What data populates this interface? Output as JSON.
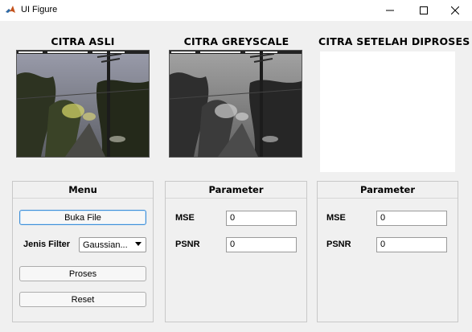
{
  "window": {
    "title": "UI Figure",
    "app_icon": "matlab-icon",
    "controls": [
      "minimize-icon",
      "maximize-icon",
      "close-icon"
    ]
  },
  "images": {
    "original_title": "CITRA ASLI",
    "greyscale_title": "CITRA GREYSCALE",
    "processed_title": "CITRA SETELAH DIPROSES"
  },
  "menu_panel": {
    "title": "Menu",
    "open_file_label": "Buka File",
    "filter_label": "Jenis Filter",
    "filter_selected": "Gaussian...",
    "process_label": "Proses",
    "reset_label": "Reset"
  },
  "param_panel_1": {
    "title": "Parameter",
    "mse_label": "MSE",
    "mse_value": "0",
    "psnr_label": "PSNR",
    "psnr_value": "0"
  },
  "param_panel_2": {
    "title": "Parameter",
    "mse_label": "MSE",
    "mse_value": "0",
    "psnr_label": "PSNR",
    "psnr_value": "0"
  },
  "colors": {
    "background": "#f0f0f0",
    "focus_border": "#3f8fd8"
  }
}
